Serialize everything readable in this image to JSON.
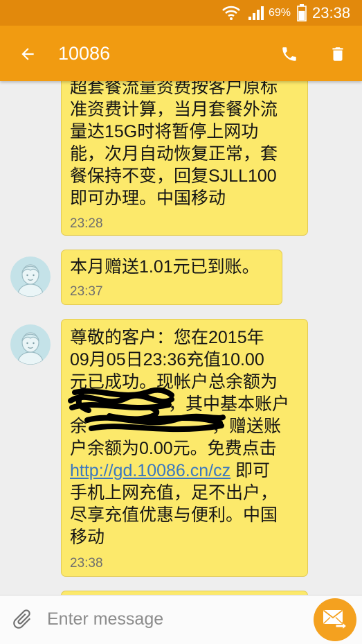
{
  "status_bar": {
    "battery_text": "69%",
    "battery_level": 0.69,
    "time": "23:38",
    "icons": [
      "wifi-icon",
      "signal-icon",
      "battery-icon"
    ]
  },
  "app_bar": {
    "title": "10086",
    "back_icon": "arrow-back-icon",
    "actions": [
      "phone-icon",
      "delete-icon"
    ]
  },
  "messages": [
    {
      "lines": [
        {
          "text": "超套餐流量资费按客户原标"
        },
        {
          "text": "准资费计算，当月套餐外流"
        },
        {
          "text": "量达15G时将暂停上网功"
        },
        {
          "text": "能，次月自动恢复正常，套"
        },
        {
          "text": "餐保持不变，回复SJLL100"
        },
        {
          "text": "即可办理。中国移动"
        }
      ],
      "time": "23:28"
    },
    {
      "lines": [
        {
          "text": "本月赠送1.01元已到账。"
        }
      ],
      "time": "23:37"
    },
    {
      "lines": [
        {
          "text": "尊敬的客户：您在2015年"
        },
        {
          "text": "09月05日23:36充值10.00"
        },
        {
          "text": "元已成功。现帐户总余额为"
        },
        {
          "text": "，其中基本账户"
        },
        {
          "segments": [
            "余",
            "，赠送账"
          ]
        },
        {
          "text": "户余额为0.00元。免费点击"
        },
        {
          "link": "http://gd.10086.cn/cz",
          "text": " 即可"
        },
        {
          "text": "手机上网充值，足不出户，"
        },
        {
          "text": "尽享充值优惠与便利。中国"
        },
        {
          "text": "移动"
        }
      ],
      "time": "23:38"
    }
  ],
  "composer": {
    "placeholder": "Enter message",
    "attach_icon": "paperclip-icon",
    "send_icon": "send-envelope-icon"
  },
  "colors": {
    "status_bar": "#e2890c",
    "app_bar": "#f19b11",
    "list_background": "#eeeeee",
    "bubble": "#fce96b",
    "bubble_border": "#e3cb53",
    "link": "#3a78c1",
    "send_button": "#f4a11f"
  }
}
